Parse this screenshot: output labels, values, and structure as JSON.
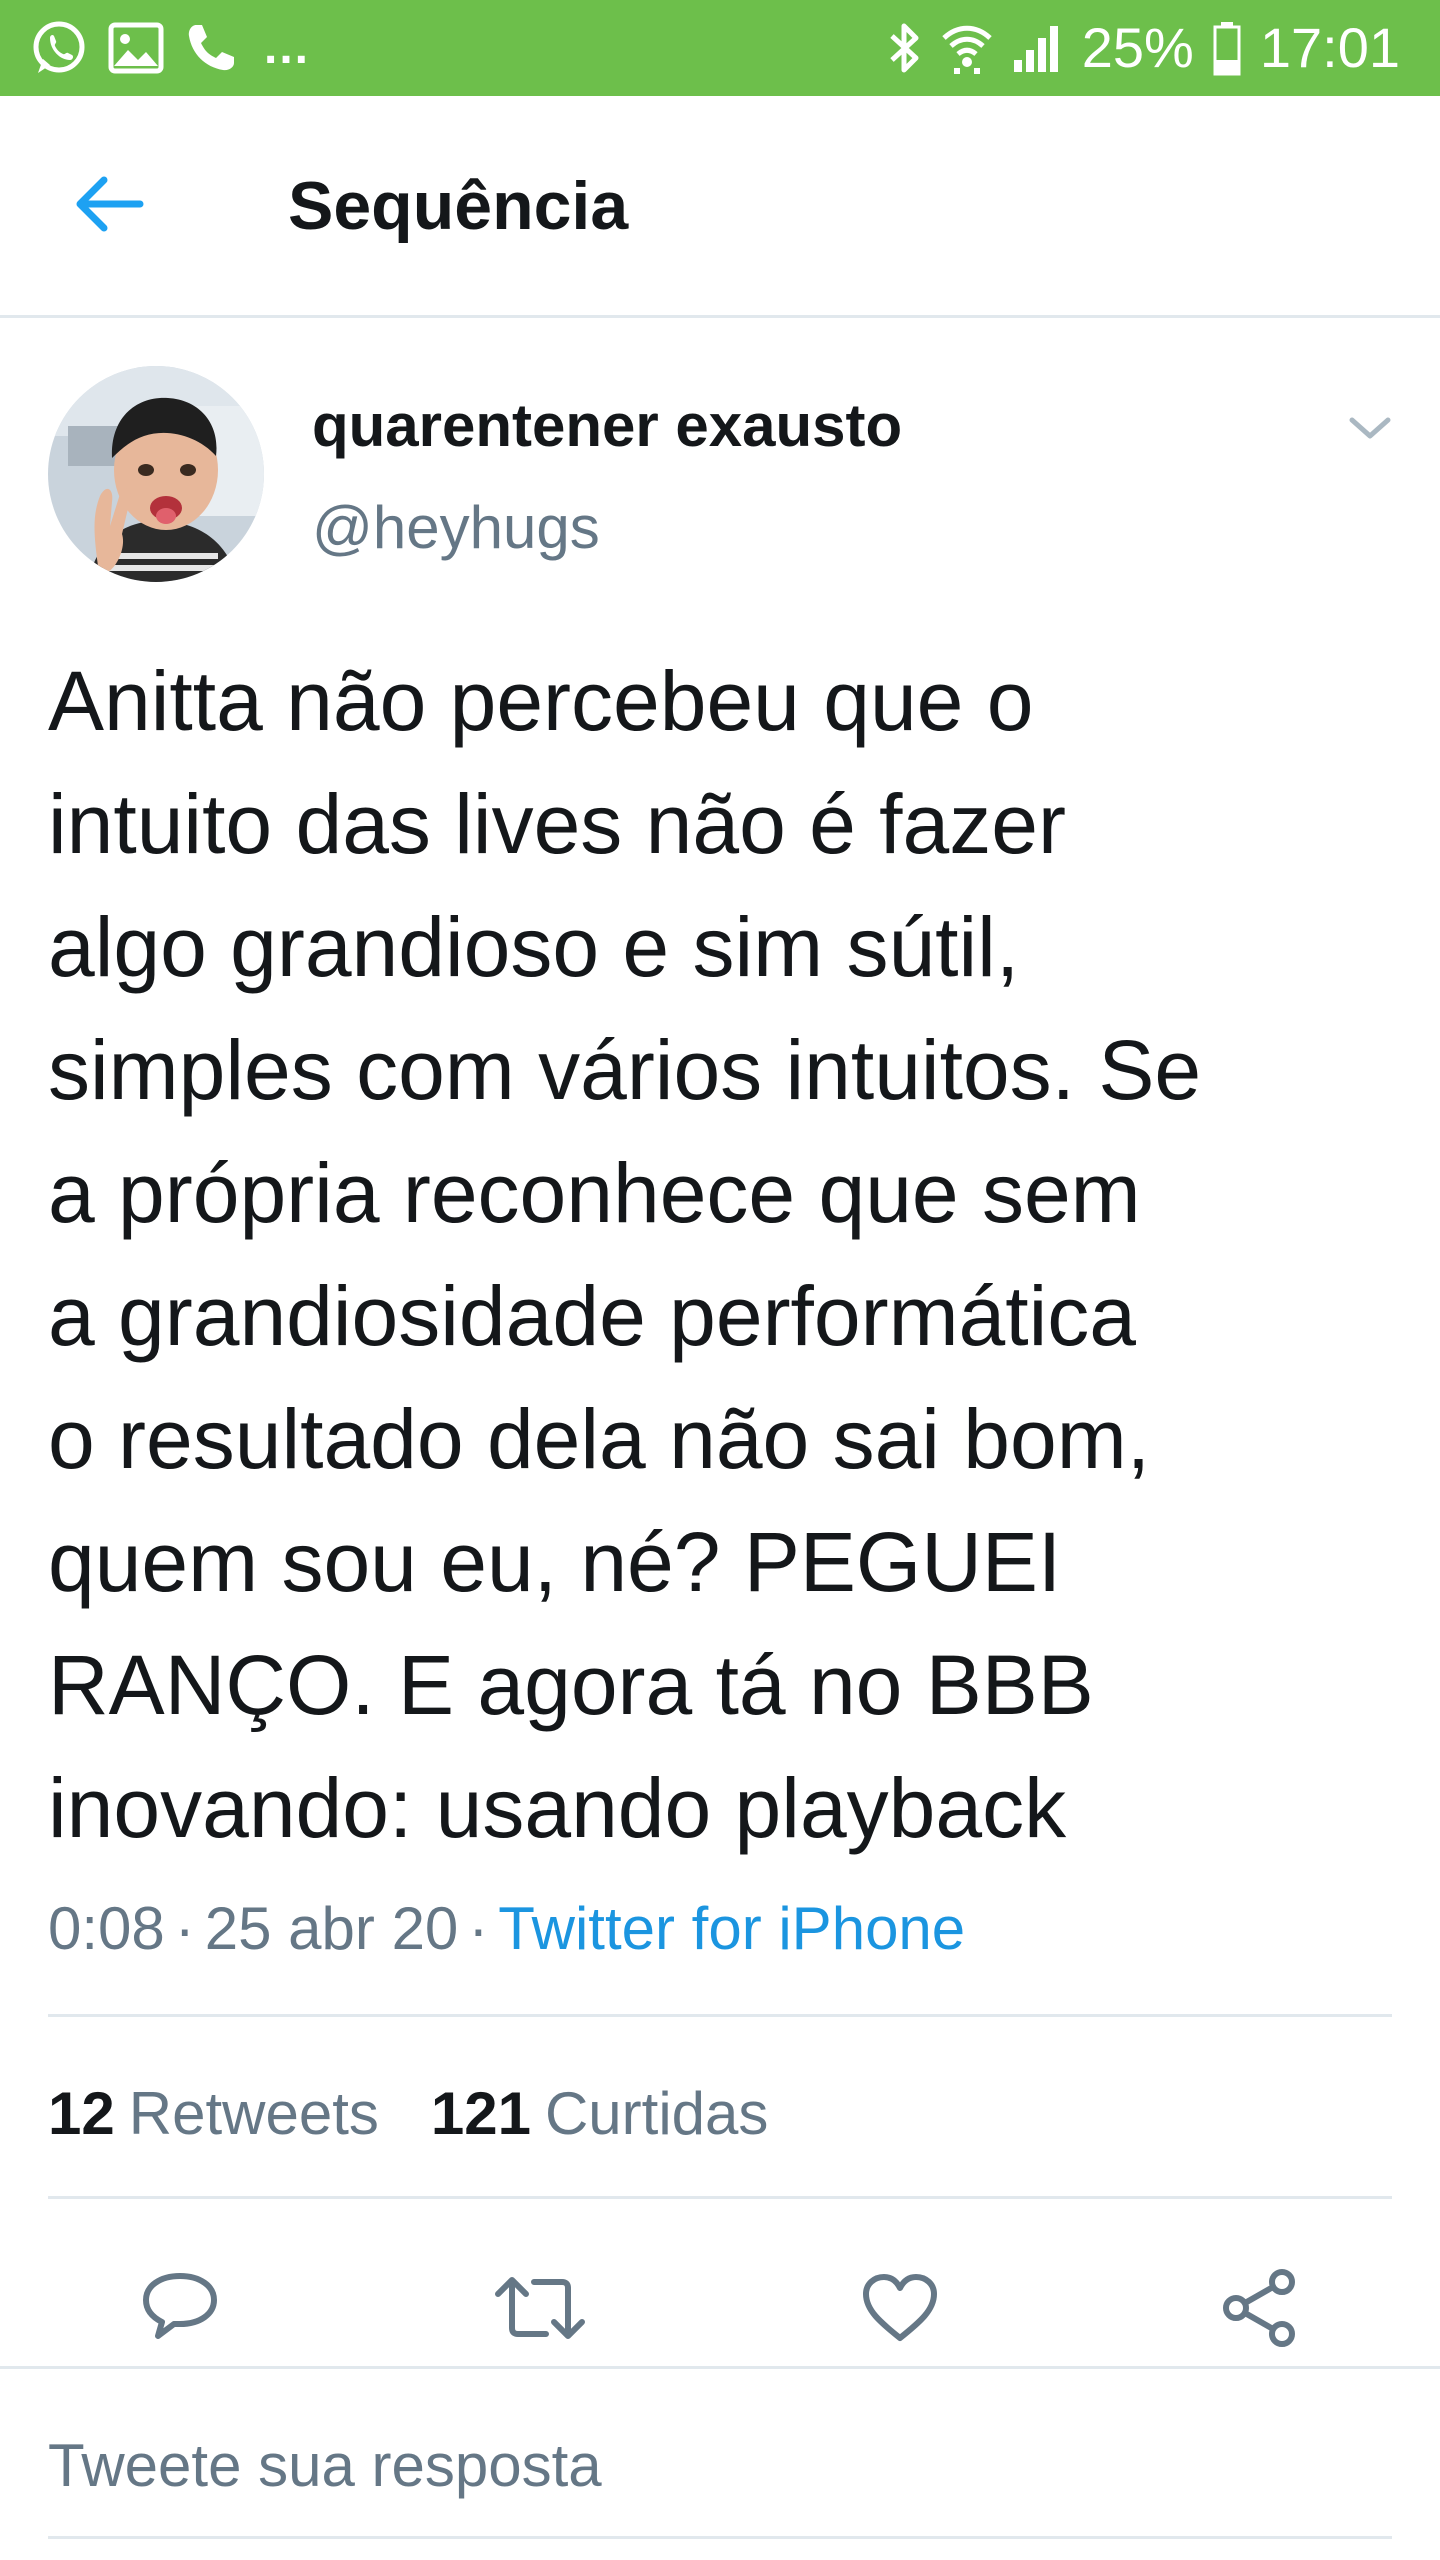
{
  "status_bar": {
    "left_icons": [
      "whatsapp-icon",
      "image-icon",
      "phone-icon"
    ],
    "more": "...",
    "battery_percent": "25%",
    "time": "17:01",
    "right_icons": [
      "bluetooth-icon",
      "wifi-icon",
      "signal-icon",
      "battery-icon"
    ],
    "background_color": "#6dbf4b"
  },
  "header": {
    "back_icon": "arrow-left-icon",
    "title": "Sequência"
  },
  "tweet": {
    "author": {
      "display_name": "quarentener exausto",
      "handle": "@heyhugs"
    },
    "text_lines": [
      "Anitta não percebeu que o",
      "intuito das lives não é fazer",
      "algo grandioso e sim sútil,",
      "simples com vários intuitos. Se",
      "a própria reconhece que sem",
      "a grandiosidade performática",
      "o resultado dela não sai bom,",
      "quem sou eu, né? PEGUEI",
      "RANÇO. E agora tá no BBB",
      "inovando: usando playback"
    ],
    "time": "0:08",
    "date": "25 abr 20",
    "separator": "·",
    "source": "Twitter for iPhone",
    "stats": {
      "retweets_count": "12",
      "retweets_label": "Retweets",
      "likes_count": "121",
      "likes_label": "Curtidas"
    },
    "actions": [
      "reply-icon",
      "retweet-icon",
      "like-icon",
      "share-icon"
    ]
  },
  "reply": {
    "placeholder": "Tweete sua resposta"
  },
  "colors": {
    "link": "#1b95e0",
    "secondary_text": "#657786",
    "primary_text": "#14171a",
    "divider": "#e1e8ed",
    "icon_gray": "#657786"
  }
}
